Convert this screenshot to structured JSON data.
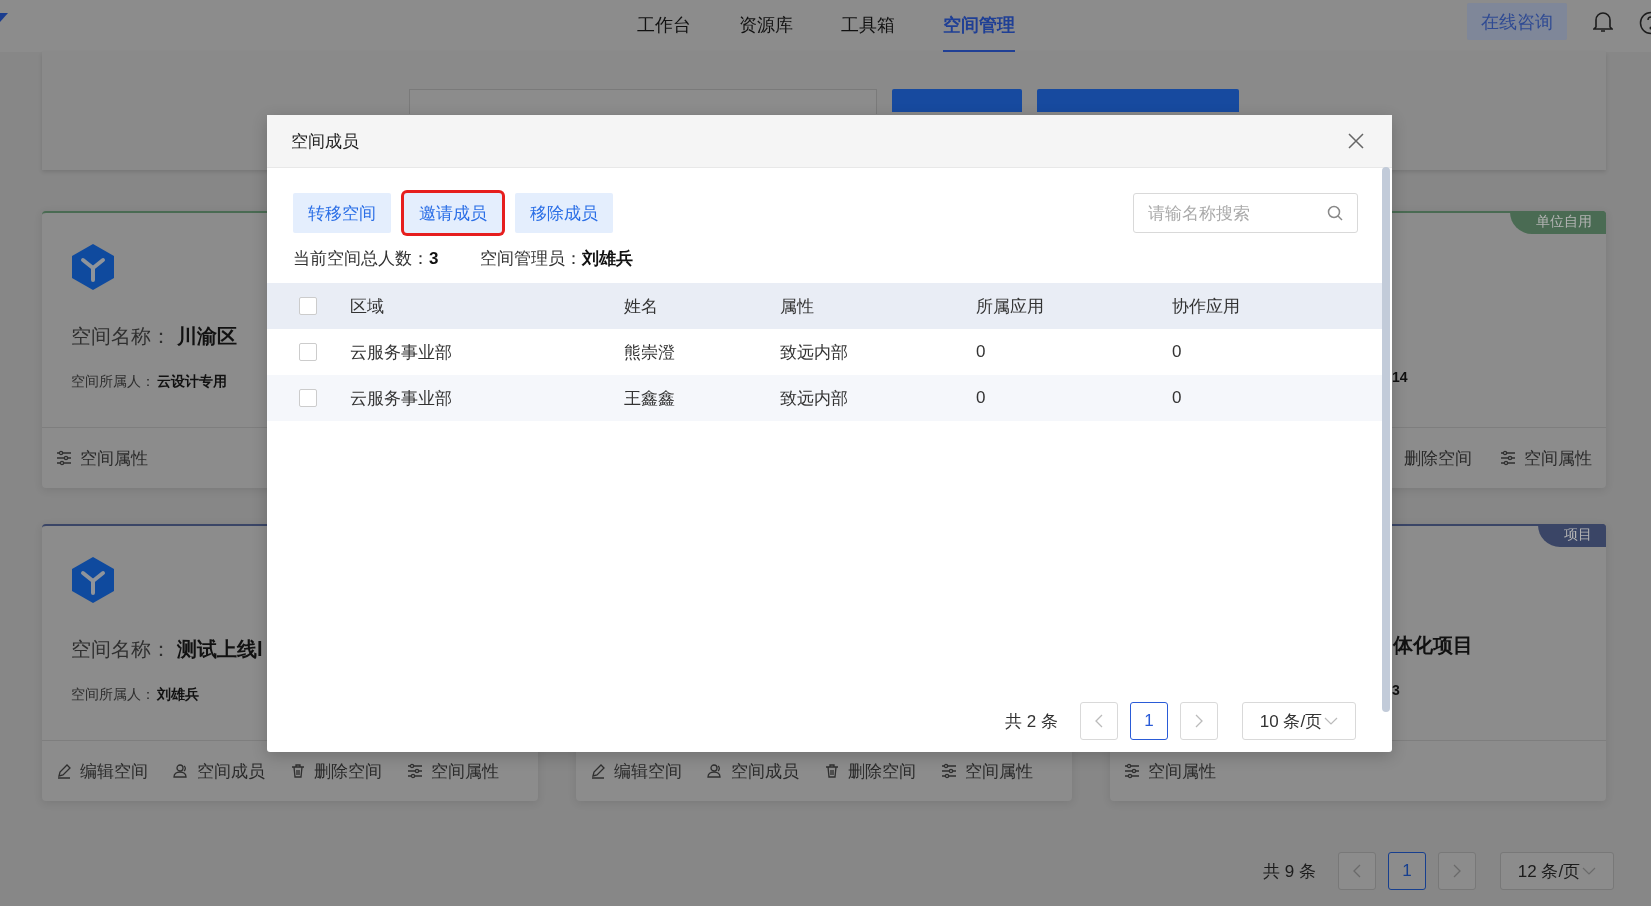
{
  "nav": {
    "tabs": [
      {
        "label": "工作台",
        "selected": false
      },
      {
        "label": "资源库",
        "selected": false
      },
      {
        "label": "工具箱",
        "selected": false
      },
      {
        "label": "空间管理",
        "selected": true
      }
    ],
    "consult_button": "在线咨询"
  },
  "cards": [
    {
      "color": "#4a6b53",
      "name_label": "空间名称：",
      "name": "川渝区",
      "owner_label": "空间所属人：",
      "owner": "云设计专用",
      "actions": [
        {
          "label": "空间属性",
          "kind": "settings"
        }
      ]
    },
    {
      "color": "#4a6b53",
      "tag": "单位自用",
      "owner": "14",
      "actions": [
        {
          "label": "删除空间"
        },
        {
          "label": "空间属性",
          "kind": "settings"
        }
      ]
    },
    {
      "color": "#3a4566",
      "name_label": "空间名称：",
      "name": "测试上线l",
      "owner_label": "空间所属人：",
      "owner": "刘雄兵",
      "actions": [
        {
          "label": "编辑空间",
          "kind": "edit"
        },
        {
          "label": "空间成员",
          "kind": "members"
        },
        {
          "label": "删除空间",
          "kind": "delete"
        },
        {
          "label": "空间属性",
          "kind": "settings"
        }
      ]
    },
    {
      "actions": [
        {
          "label": "编辑空间",
          "kind": "edit"
        },
        {
          "label": "空间成员",
          "kind": "members"
        },
        {
          "label": "删除空间",
          "kind": "delete"
        },
        {
          "label": "空间属性",
          "kind": "settings"
        }
      ]
    },
    {
      "color": "#3a4566",
      "tag": "项目",
      "name": "体化项目",
      "owner": "3",
      "actions": [
        {
          "label": "空间属性",
          "kind": "settings"
        }
      ]
    }
  ],
  "pagination": {
    "total": "共 9 条",
    "pages": [
      {
        "label": "1",
        "selected": true
      }
    ],
    "page_size": "12 条/页"
  },
  "dialog": {
    "title": "空间成员",
    "buttons": [
      {
        "label": "转移空间",
        "annotated": false
      },
      {
        "label": "邀请成员",
        "annotated": true
      },
      {
        "label": "移除成员",
        "annotated": false
      }
    ],
    "search_placeholder": "请输名称搜索",
    "summary": [
      {
        "label": "当前空间总人数：",
        "value": "3"
      },
      {
        "label": "空间管理员：",
        "value": "刘雄兵"
      }
    ],
    "table": {
      "header_checked": false,
      "columns": [
        "区域",
        "姓名",
        "属性",
        "所属应用",
        "协作应用"
      ],
      "rows": [
        {
          "checked": false,
          "cells": [
            "云服务事业部",
            "熊崇澄",
            "致远内部",
            "0",
            "0"
          ]
        },
        {
          "checked": false,
          "cells": [
            "云服务事业部",
            "王鑫鑫",
            "致远内部",
            "0",
            "0"
          ]
        }
      ]
    },
    "pagination": {
      "total": "共 2 条",
      "pages": [
        {
          "label": "1",
          "selected": true
        }
      ],
      "page_size": "10 条/页"
    }
  }
}
